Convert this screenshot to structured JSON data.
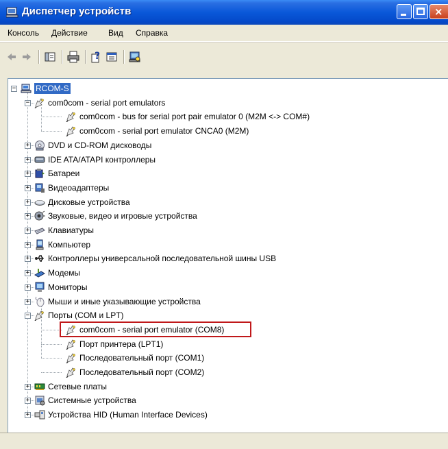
{
  "window": {
    "title": "Диспетчер устройств"
  },
  "menu": [
    "Консоль",
    "Действие",
    "Вид",
    "Справка"
  ],
  "toolbar": [
    "back-arrow-icon",
    "forward-arrow-icon",
    "show-hide-tree-icon",
    "print-icon",
    "help-icon",
    "properties-icon",
    "scan-hardware-icon"
  ],
  "tree": {
    "root": "RCOM-S",
    "com0com_group": "com0com - serial port emulators",
    "com0com_children": [
      "com0com - bus for serial port pair emulator 0 (M2M <-> COM#)",
      "com0com - serial port emulator CNCA0 (M2M)"
    ],
    "categories_before_ports": [
      "DVD и CD-ROM дисководы",
      "IDE ATA/ATAPI контроллеры",
      "Батареи",
      "Видеоадаптеры",
      "Дисковые устройства",
      "Звуковые, видео и игровые устройства",
      "Клавиатуры",
      "Компьютер",
      "Контроллеры универсальной последовательной шины USB",
      "Модемы",
      "Мониторы",
      "Мыши и иные указывающие устройства"
    ],
    "ports_group": "Порты (COM и LPT)",
    "ports_children": [
      "com0com - serial port emulator (COM8)",
      "Порт принтера (LPT1)",
      "Последовательный порт (COM1)",
      "Последовательный порт (COM2)"
    ],
    "categories_after_ports": [
      "Сетевые платы",
      "Системные устройства",
      "Устройства HID (Human Interface Devices)"
    ],
    "expand_plus": "+",
    "expand_minus": "−"
  },
  "colors": {
    "selection": "#316ac5",
    "highlight_box": "#c0181a",
    "titlebar": "#0a58d9"
  }
}
